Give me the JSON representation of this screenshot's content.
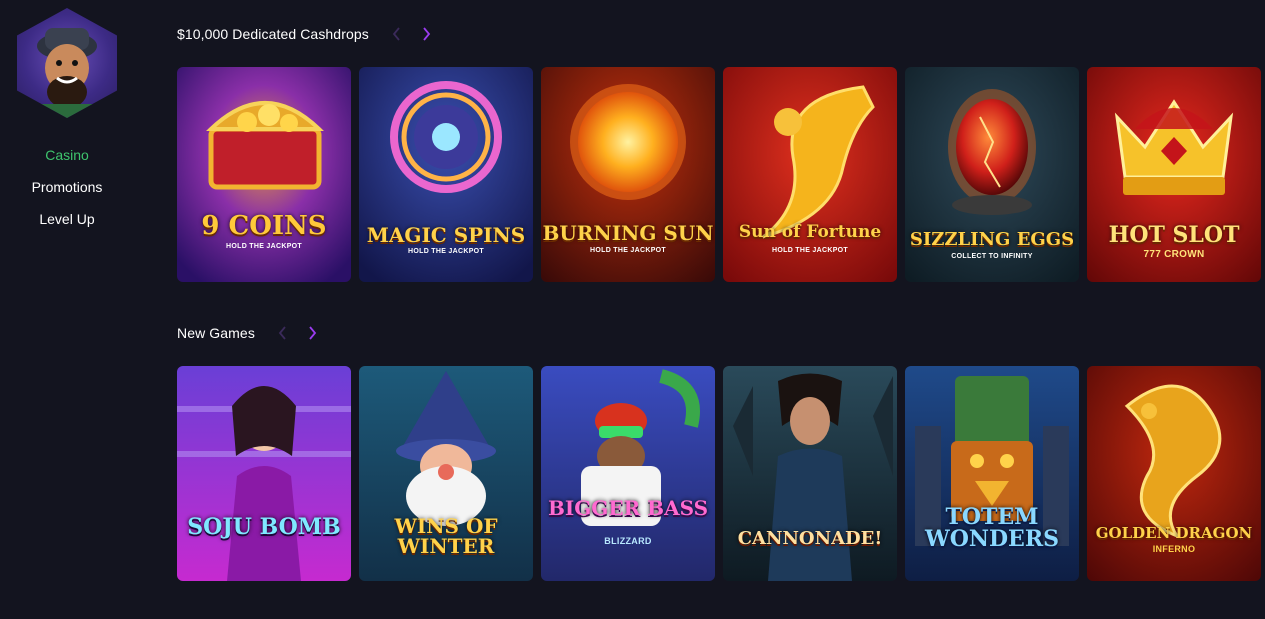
{
  "sidebar": {
    "nav": [
      {
        "label": "Casino",
        "active": true
      },
      {
        "label": "Promotions",
        "active": false
      },
      {
        "label": "Level Up",
        "active": false
      }
    ],
    "accent_color": "#3ec46d"
  },
  "sections": [
    {
      "title": "$10,000 Dedicated Cashdrops",
      "arrow_active_color": "#9b3cf0",
      "games": [
        {
          "name": "9 COINS",
          "subtitle": "HOLD THE JACKPOT"
        },
        {
          "name": "MAGIC SPINS",
          "subtitle": "HOLD THE JACKPOT"
        },
        {
          "name": "BURNING SUN",
          "subtitle": "HOLD THE JACKPOT"
        },
        {
          "name": "Sun of Fortune",
          "subtitle": "HOLD THE JACKPOT"
        },
        {
          "name": "SIZZLING EGGS",
          "subtitle": "COLLECT TO INFINITY"
        },
        {
          "name": "HOT SLOT",
          "subtitle": "777 CROWN"
        }
      ]
    },
    {
      "title": "New Games",
      "arrow_active_color": "#9b3cf0",
      "games": [
        {
          "name": "SOJU BOMB",
          "subtitle": ""
        },
        {
          "name": "WINS OF WINTER",
          "subtitle": ""
        },
        {
          "name": "BIGGER BASS",
          "subtitle": "BLIZZARD"
        },
        {
          "name": "CANNONADE!",
          "subtitle": ""
        },
        {
          "name": "TOTEM WONDERS",
          "subtitle": ""
        },
        {
          "name": "GOLDEN DRAGON",
          "subtitle": "INFERNO"
        }
      ]
    }
  ]
}
